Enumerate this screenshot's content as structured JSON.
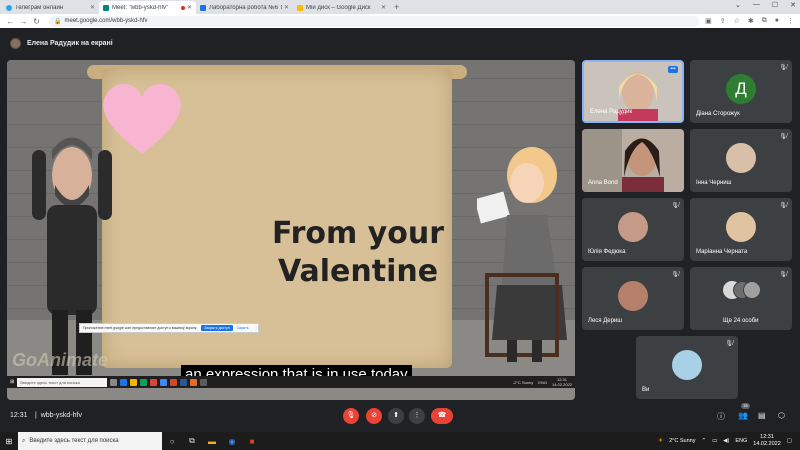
{
  "browser": {
    "tabs": [
      {
        "title": "Телеграм онлайн",
        "color": "#2ca5e0",
        "active": false
      },
      {
        "title": "Meet: \"wbb-yskd-hfv\"",
        "color": "#00897b",
        "active": true
      },
      {
        "title": "Лабораторна робота №6 Техн",
        "color": "#1a73e8",
        "active": false
      },
      {
        "title": "Мій диск – Google Диск",
        "color": "#fbbc04",
        "active": false
      }
    ],
    "url": "meet.google.com/wbb-yskd-hfv"
  },
  "meet": {
    "presenter_text": "Елена Радудик на екрані",
    "caption": "an expression that is in use today",
    "slide_title": "From your Valentine",
    "slide_watermark": "GoAnimate",
    "share_notice": {
      "text": "Приложение meet.google.com предоставляет доступ к вашему экрану.",
      "share_label": "Закрыть доступ",
      "hide_label": "Скрыть"
    },
    "inner_search": "Введите здесь текст для поиска",
    "inner_weather": "-2°C Sunny",
    "inner_lang": "ENG",
    "inner_time": "12:31",
    "inner_date": "14.02.2022",
    "participants": [
      {
        "name": "Елена Радудик",
        "type": "video",
        "speaking": true,
        "color": "#c8a88c"
      },
      {
        "name": "Діана Сторожук",
        "type": "letter",
        "letter": "Д",
        "color": "#2e7d32"
      },
      {
        "name": "Anna Bond",
        "type": "video",
        "color": "#8a6a55"
      },
      {
        "name": "Інна Черниш",
        "type": "photo",
        "color": "#d8c0a8"
      },
      {
        "name": "Юлія Федюка",
        "type": "photo",
        "color": "#c59a86"
      },
      {
        "name": "Маріанна Черната",
        "type": "photo",
        "color": "#e0c3a0"
      },
      {
        "name": "Леся Дериш",
        "type": "photo",
        "color": "#b5806a"
      },
      {
        "name": "Ще 24 особи",
        "type": "group",
        "color": "#707070"
      },
      {
        "name": "Ви",
        "type": "photo",
        "color": "#a8d0e6"
      }
    ],
    "time": "12:31",
    "code": "wbb-yskd-hfv",
    "participant_count": "35"
  },
  "taskbar": {
    "search_placeholder": "Введите здесь текст для поиска",
    "weather": "2°C  Sunny",
    "lang": "ENG",
    "time": "12:31",
    "date": "14.02.2022"
  },
  "colors": {
    "accent": "#1a73e8",
    "hangup": "#ea4335",
    "meet_bg": "#202124"
  }
}
